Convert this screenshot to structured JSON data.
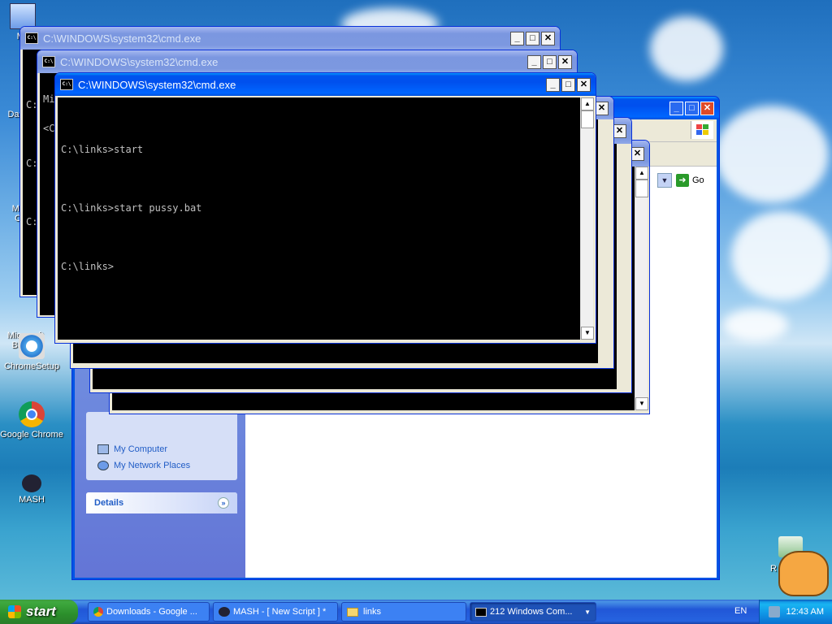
{
  "desktop": {
    "icons": [
      {
        "label": "My",
        "icon": "my-documents-icon"
      },
      {
        "label": "Dat",
        "icon": "data-icon"
      },
      {
        "label": "Micr\nC",
        "icon": "microsoft-icon"
      },
      {
        "label": "Microsoft\nBasic",
        "icon": "microsoft-basic-icon"
      },
      {
        "label": "ChromeSetup",
        "icon": "chrome-setup-icon"
      },
      {
        "label": "Google Chrome",
        "icon": "chrome-icon"
      },
      {
        "label": "MASH",
        "icon": "mash-icon"
      }
    ],
    "recycle_label": "R"
  },
  "cmd_windows": [
    {
      "title": "C:\\WINDOWS\\system32\\cmd.exe",
      "partial_lines": [
        "C:",
        "C:",
        "C:"
      ]
    },
    {
      "title": "C:\\WINDOWS\\system32\\cmd.exe",
      "partial_lines": [
        "Mi",
        "<C"
      ]
    },
    {
      "title": "C:\\WINDOWS\\system32\\cmd.exe",
      "lines": [
        "C:\\links>start",
        "C:\\links>start pussy.bat",
        "C:\\links>"
      ]
    }
  ],
  "explorer": {
    "go_label": "Go",
    "places": [
      "My Computer",
      "My Network Places"
    ],
    "details_label": "Details"
  },
  "taskbar": {
    "start_label": "start",
    "tasks": [
      {
        "label": "Downloads - Google ...",
        "icon": "chrome-icon"
      },
      {
        "label": "MASH - [ New Script ] *",
        "icon": "mash-icon"
      },
      {
        "label": "links",
        "icon": "folder-icon"
      },
      {
        "label": "212 Windows Com...",
        "icon": "cmd-icon"
      }
    ],
    "lang": "EN",
    "clock": "12:43 AM"
  }
}
